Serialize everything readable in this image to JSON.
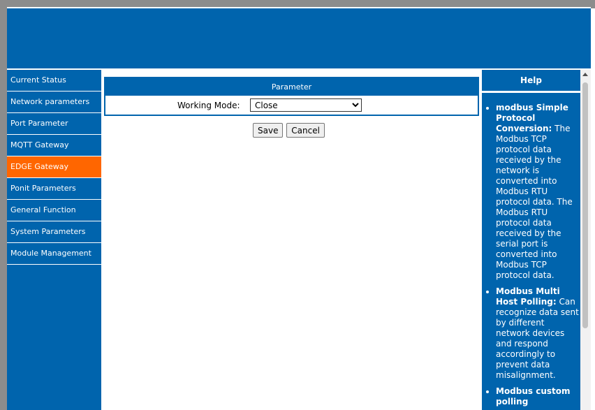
{
  "sidebar": {
    "items": [
      {
        "label": "Current Status",
        "active": false
      },
      {
        "label": "Network parameters",
        "active": false
      },
      {
        "label": "Port Parameter",
        "active": false
      },
      {
        "label": "MQTT Gateway",
        "active": false
      },
      {
        "label": "EDGE Gateway",
        "active": true
      },
      {
        "label": "Ponit Parameters",
        "active": false
      },
      {
        "label": "General Function",
        "active": false
      },
      {
        "label": "System Parameters",
        "active": false
      },
      {
        "label": "Module Management",
        "active": false
      }
    ]
  },
  "main": {
    "section_title": "Parameter",
    "working_mode": {
      "label": "Working Mode:",
      "value": "Close",
      "options": [
        "Close"
      ]
    },
    "save_label": "Save",
    "cancel_label": "Cancel"
  },
  "help": {
    "title": "Help",
    "items": [
      {
        "term": "modbus Simple Protocol Conversion:",
        "text": "The Modbus TCP protocol data received by the network is converted into Modbus RTU protocol data. The Modbus RTU protocol data received by the serial port is converted into Modbus TCP protocol data."
      },
      {
        "term": "Modbus Multi Host Polling:",
        "text": "Can recognize data sent by different network devices and respond accordingly to prevent data misalignment."
      },
      {
        "term": "Modbus custom polling",
        "text": ""
      }
    ]
  },
  "colors": {
    "primary": "#0064ad",
    "active": "#ff6600",
    "frame": "#8c8c8c"
  }
}
